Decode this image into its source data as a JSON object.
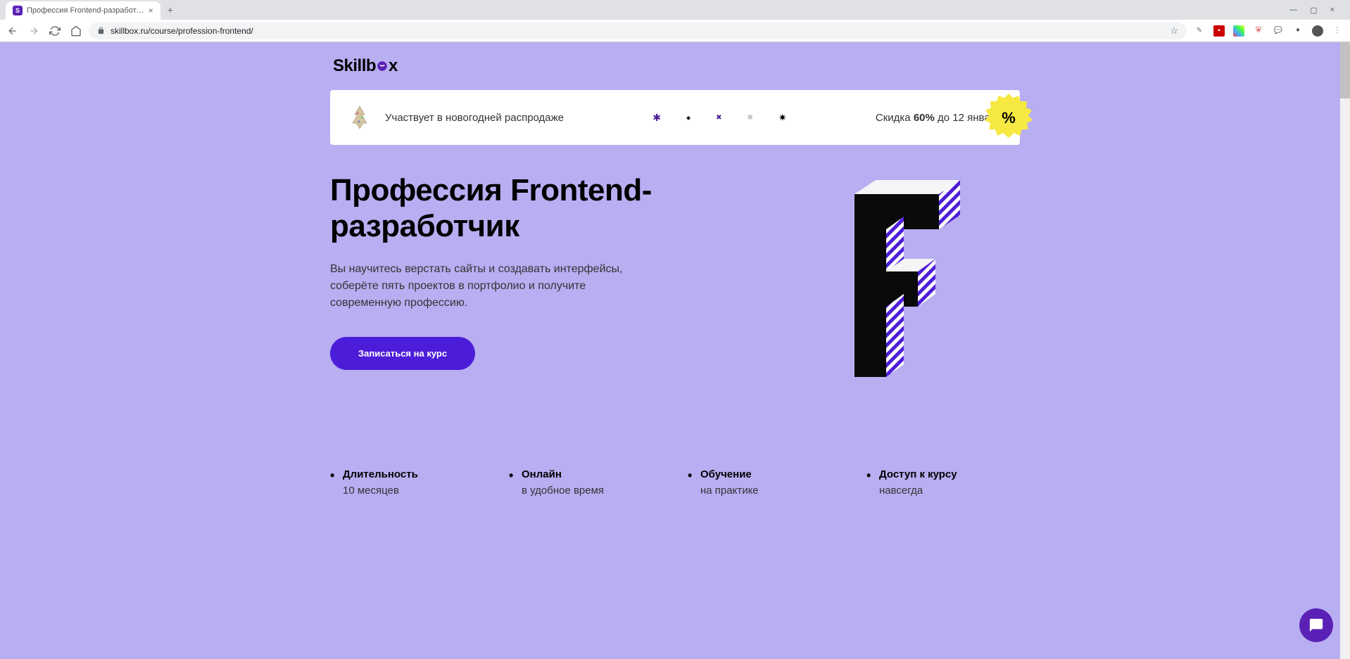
{
  "browser": {
    "tab_title": "Профессия Frontend-разработ…",
    "url": "skillbox.ru/course/profession-frontend/"
  },
  "logo": "Skillb",
  "logo_suffix": "x",
  "promo": {
    "text": "Участвует в новогодней распродаже",
    "discount_prefix": "Скидка ",
    "discount_percent": "60%",
    "discount_suffix": " до 12 января",
    "badge_symbol": "%"
  },
  "hero": {
    "title": "Профессия Frontend-разработчик",
    "description": "Вы научитесь верстать сайты и создавать интерфейсы, соберёте пять проектов в портфолио и получите современную профессию.",
    "cta": "Записаться на курс"
  },
  "features": [
    {
      "title": "Длительность",
      "value": "10 месяцев"
    },
    {
      "title": "Онлайн",
      "value": "в удобное время"
    },
    {
      "title": "Обучение",
      "value": "на практике"
    },
    {
      "title": "Доступ к курсу",
      "value": "навсегда"
    }
  ]
}
